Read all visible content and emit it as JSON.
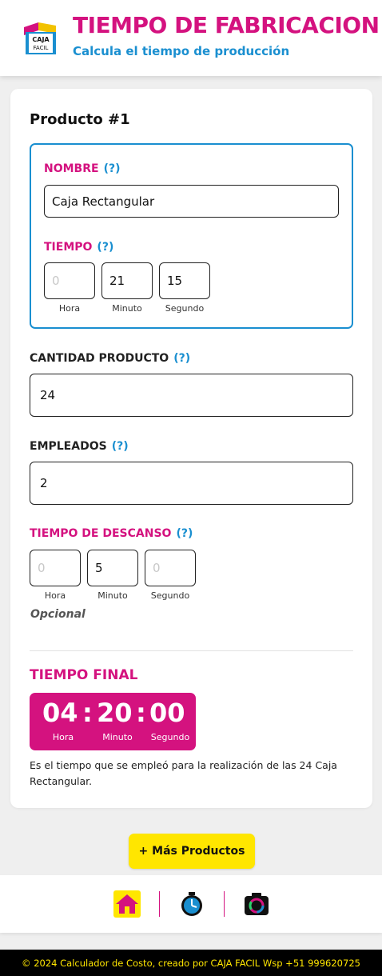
{
  "header": {
    "title": "TIEMPO DE FABRICACION",
    "subtitle": "Calcula el tiempo de producción",
    "logo_text_top": "CAJA",
    "logo_text_bottom": "FACIL"
  },
  "product": {
    "title": "Producto #1",
    "name_label": "NOMBRE",
    "name_value": "Caja Rectangular",
    "time_label": "TIEMPO",
    "time_hours_placeholder": "0",
    "time_minutes": "21",
    "time_seconds": "15"
  },
  "units": {
    "hours": "Hora",
    "minutes": "Minuto",
    "seconds": "Segundo"
  },
  "help": "(?)",
  "quantity": {
    "label": "CANTIDAD PRODUCTO",
    "value": "24"
  },
  "employees": {
    "label": "EMPLEADOS",
    "value": "2"
  },
  "break_time": {
    "label": "TIEMPO DE DESCANSO",
    "hours_placeholder": "0",
    "minutes": "5",
    "seconds_placeholder": "0",
    "note": "Opcional"
  },
  "final": {
    "label": "TIEMPO FINAL",
    "hours": "04",
    "minutes": "20",
    "seconds": "00",
    "separator": ":",
    "description": "Es el tiempo que se empleó para la realización de las 24 Caja Rectangular."
  },
  "more_button": "+ Más Productos",
  "nav": {
    "icons": [
      "home-icon",
      "stopwatch-icon",
      "camera-icon"
    ]
  },
  "footer": "© 2024 Calculador de Costo, creado por CAJA FACIL Wsp +51 999620725",
  "colors": {
    "pink": "#d4127f",
    "blue": "#1a8fd0",
    "yellow": "#ffe600"
  }
}
